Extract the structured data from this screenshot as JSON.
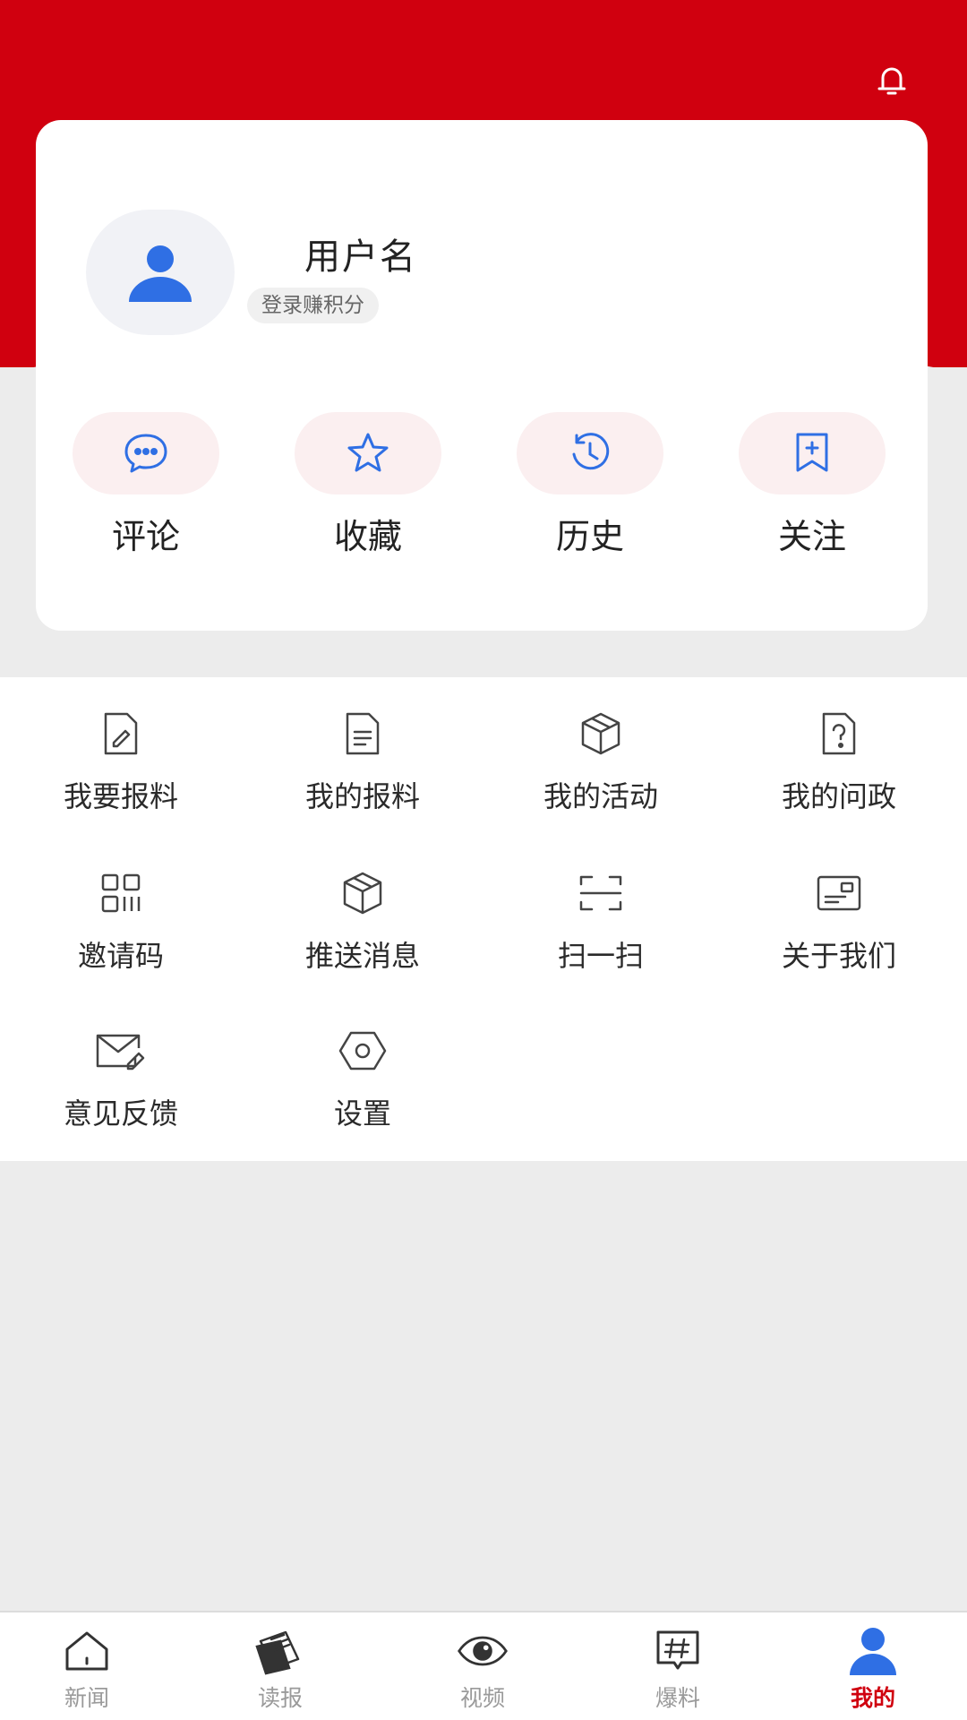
{
  "colors": {
    "brand_red": "#d0000f",
    "icon_blue": "#2f6fe4",
    "background": "#ececec"
  },
  "header": {
    "bell_icon": "bell-icon"
  },
  "profile": {
    "username": "用户名",
    "login_tag": "登录赚积分",
    "avatar_icon": "user-icon"
  },
  "quick_actions": [
    {
      "label": "评论",
      "icon": "comment-icon"
    },
    {
      "label": "收藏",
      "icon": "star-icon"
    },
    {
      "label": "历史",
      "icon": "clock-icon"
    },
    {
      "label": "关注",
      "icon": "bookmark-plus-icon"
    }
  ],
  "menu": [
    {
      "label": "我要报料",
      "icon": "edit-doc-icon"
    },
    {
      "label": "我的报料",
      "icon": "doc-icon"
    },
    {
      "label": "我的活动",
      "icon": "box-icon"
    },
    {
      "label": "我的问政",
      "icon": "question-doc-icon"
    },
    {
      "label": "邀请码",
      "icon": "qrcode-icon"
    },
    {
      "label": "推送消息",
      "icon": "box-icon"
    },
    {
      "label": "扫一扫",
      "icon": "scan-icon"
    },
    {
      "label": "关于我们",
      "icon": "id-card-icon"
    },
    {
      "label": "意见反馈",
      "icon": "mail-edit-icon"
    },
    {
      "label": "设置",
      "icon": "hexagon-settings-icon"
    }
  ],
  "tabbar": [
    {
      "label": "新闻",
      "icon": "home-icon",
      "active": false
    },
    {
      "label": "读报",
      "icon": "newspaper-icon",
      "active": false
    },
    {
      "label": "视频",
      "icon": "eye-icon",
      "active": false
    },
    {
      "label": "爆料",
      "icon": "hashtag-icon",
      "active": false
    },
    {
      "label": "我的",
      "icon": "user-icon",
      "active": true
    }
  ]
}
